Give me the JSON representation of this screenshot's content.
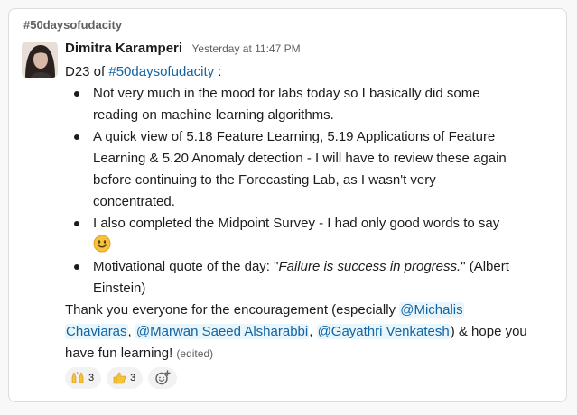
{
  "channel": "#50daysofudacity",
  "message": {
    "author": "Dimitra Karamperi",
    "timestamp": "Yesterday at 11:47 PM",
    "intro_prefix": "D23 of ",
    "intro_tag": "#50daysofudacity",
    "intro_suffix": " :",
    "bullets": [
      {
        "lines": [
          "Not very much in the mood for labs today so I basically did some",
          "reading on machine learning algorithms."
        ]
      },
      {
        "lines": [
          "A quick view of 5.18 Feature Learning, 5.19 Applications of Feature",
          "Learning & 5.20 Anomaly detection - I will have to review these again",
          "before continuing to the Forecasting Lab, as I wasn't very",
          "concentrated."
        ]
      },
      {
        "lines": [
          "I also completed the Midpoint Survey - I had only good words to say"
        ],
        "emoji": "slightly-smiling-face"
      },
      {
        "prefix": "Motivational quote of the day: \"",
        "quote": "Failure is success in progress.",
        "suffix": "\" (Albert",
        "line2": "Einstein)"
      }
    ],
    "closing": {
      "line1_prefix": "Thank you everyone for the encouragement (especially ",
      "mention1_a": "@Michalis",
      "mention1_b": "Chaviaras",
      "sep1": ", ",
      "mention2": "@Marwan Saeed Alsharabbi",
      "sep2": ", ",
      "mention3": "@Gayathri Venkatesh",
      "line2_suffix": ") & hope you",
      "line3": "have fun learning! ",
      "edited": "(edited)"
    }
  },
  "reactions": [
    {
      "icon": "raised-hands-icon",
      "count": "3"
    },
    {
      "icon": "thumbs-up-icon",
      "count": "3"
    }
  ],
  "colors": {
    "link": "#1264a3",
    "mention_bg": "#e8f5fa",
    "muted": "#616061",
    "emoji_yellow": "#f7c33b"
  }
}
